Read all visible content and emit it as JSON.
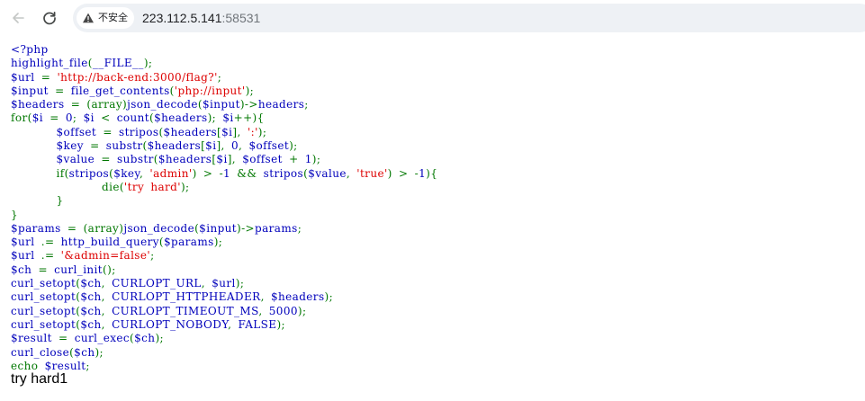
{
  "browser": {
    "security_label": "不安全",
    "url_host": "223.112.5.141",
    "url_port": ":58531",
    "icons": {
      "back": "arrow-left-icon",
      "reload": "reload-icon",
      "security": "warning-triangle-icon"
    }
  },
  "colors": {
    "php_default": "#0000bb",
    "php_keyword": "#007700",
    "php_string": "#dd0000",
    "php_html": "#000000"
  },
  "code_lines": [
    [
      {
        "t": "&lt;?php",
        "c": "default"
      }
    ],
    [
      {
        "t": "highlight_file",
        "c": "default"
      },
      {
        "t": "(",
        "c": "keyword"
      },
      {
        "t": "__FILE__",
        "c": "default"
      },
      {
        "t": ");",
        "c": "keyword"
      }
    ],
    [
      {
        "t": "$url ",
        "c": "default"
      },
      {
        "t": "= ",
        "c": "keyword"
      },
      {
        "t": "'http://back-end:3000/flag?'",
        "c": "string"
      },
      {
        "t": ";",
        "c": "keyword"
      }
    ],
    [
      {
        "t": "$input ",
        "c": "default"
      },
      {
        "t": "= ",
        "c": "keyword"
      },
      {
        "t": "file_get_contents",
        "c": "default"
      },
      {
        "t": "(",
        "c": "keyword"
      },
      {
        "t": "'php://input'",
        "c": "string"
      },
      {
        "t": ");",
        "c": "keyword"
      }
    ],
    [
      {
        "t": "$headers ",
        "c": "default"
      },
      {
        "t": "= (array)",
        "c": "keyword"
      },
      {
        "t": "json_decode",
        "c": "default"
      },
      {
        "t": "(",
        "c": "keyword"
      },
      {
        "t": "$input",
        "c": "default"
      },
      {
        "t": ")-&gt;",
        "c": "keyword"
      },
      {
        "t": "headers",
        "c": "default"
      },
      {
        "t": ";",
        "c": "keyword"
      }
    ],
    [
      {
        "t": "for(",
        "c": "keyword"
      },
      {
        "t": "$i ",
        "c": "default"
      },
      {
        "t": "= ",
        "c": "keyword"
      },
      {
        "t": "0",
        "c": "default"
      },
      {
        "t": "; ",
        "c": "keyword"
      },
      {
        "t": "$i ",
        "c": "default"
      },
      {
        "t": "&lt; ",
        "c": "keyword"
      },
      {
        "t": "count",
        "c": "default"
      },
      {
        "t": "(",
        "c": "keyword"
      },
      {
        "t": "$headers",
        "c": "default"
      },
      {
        "t": "); ",
        "c": "keyword"
      },
      {
        "t": "$i",
        "c": "default"
      },
      {
        "t": "++){",
        "c": "keyword"
      }
    ],
    [
      {
        "t": "       ",
        "c": "keyword"
      },
      {
        "t": "$offset ",
        "c": "default"
      },
      {
        "t": "= ",
        "c": "keyword"
      },
      {
        "t": "stripos",
        "c": "default"
      },
      {
        "t": "(",
        "c": "keyword"
      },
      {
        "t": "$headers",
        "c": "default"
      },
      {
        "t": "[",
        "c": "keyword"
      },
      {
        "t": "$i",
        "c": "default"
      },
      {
        "t": "], ",
        "c": "keyword"
      },
      {
        "t": "':'",
        "c": "string"
      },
      {
        "t": ");",
        "c": "keyword"
      }
    ],
    [
      {
        "t": "       ",
        "c": "keyword"
      },
      {
        "t": "$key ",
        "c": "default"
      },
      {
        "t": "= ",
        "c": "keyword"
      },
      {
        "t": "substr",
        "c": "default"
      },
      {
        "t": "(",
        "c": "keyword"
      },
      {
        "t": "$headers",
        "c": "default"
      },
      {
        "t": "[",
        "c": "keyword"
      },
      {
        "t": "$i",
        "c": "default"
      },
      {
        "t": "], ",
        "c": "keyword"
      },
      {
        "t": "0",
        "c": "default"
      },
      {
        "t": ", ",
        "c": "keyword"
      },
      {
        "t": "$offset",
        "c": "default"
      },
      {
        "t": ");",
        "c": "keyword"
      }
    ],
    [
      {
        "t": "       ",
        "c": "keyword"
      },
      {
        "t": "$value ",
        "c": "default"
      },
      {
        "t": "= ",
        "c": "keyword"
      },
      {
        "t": "substr",
        "c": "default"
      },
      {
        "t": "(",
        "c": "keyword"
      },
      {
        "t": "$headers",
        "c": "default"
      },
      {
        "t": "[",
        "c": "keyword"
      },
      {
        "t": "$i",
        "c": "default"
      },
      {
        "t": "], ",
        "c": "keyword"
      },
      {
        "t": "$offset ",
        "c": "default"
      },
      {
        "t": "+ ",
        "c": "keyword"
      },
      {
        "t": "1",
        "c": "default"
      },
      {
        "t": ");",
        "c": "keyword"
      }
    ],
    [
      {
        "t": "       if(",
        "c": "keyword"
      },
      {
        "t": "stripos",
        "c": "default"
      },
      {
        "t": "(",
        "c": "keyword"
      },
      {
        "t": "$key",
        "c": "default"
      },
      {
        "t": ", ",
        "c": "keyword"
      },
      {
        "t": "'admin'",
        "c": "string"
      },
      {
        "t": ") &gt; -",
        "c": "keyword"
      },
      {
        "t": "1 ",
        "c": "default"
      },
      {
        "t": "&amp;&amp; ",
        "c": "keyword"
      },
      {
        "t": "stripos",
        "c": "default"
      },
      {
        "t": "(",
        "c": "keyword"
      },
      {
        "t": "$value",
        "c": "default"
      },
      {
        "t": ", ",
        "c": "keyword"
      },
      {
        "t": "'true'",
        "c": "string"
      },
      {
        "t": ") &gt; -",
        "c": "keyword"
      },
      {
        "t": "1",
        "c": "default"
      },
      {
        "t": "){",
        "c": "keyword"
      }
    ],
    [
      {
        "t": "              die(",
        "c": "keyword"
      },
      {
        "t": "'try hard'",
        "c": "string"
      },
      {
        "t": ");",
        "c": "keyword"
      }
    ],
    [
      {
        "t": "       }",
        "c": "keyword"
      }
    ],
    [
      {
        "t": "}",
        "c": "keyword"
      }
    ],
    [
      {
        "t": "$params ",
        "c": "default"
      },
      {
        "t": "= (array)",
        "c": "keyword"
      },
      {
        "t": "json_decode",
        "c": "default"
      },
      {
        "t": "(",
        "c": "keyword"
      },
      {
        "t": "$input",
        "c": "default"
      },
      {
        "t": ")-&gt;",
        "c": "keyword"
      },
      {
        "t": "params",
        "c": "default"
      },
      {
        "t": ";",
        "c": "keyword"
      }
    ],
    [
      {
        "t": "$url ",
        "c": "default"
      },
      {
        "t": ".= ",
        "c": "keyword"
      },
      {
        "t": "http_build_query",
        "c": "default"
      },
      {
        "t": "(",
        "c": "keyword"
      },
      {
        "t": "$params",
        "c": "default"
      },
      {
        "t": ");",
        "c": "keyword"
      }
    ],
    [
      {
        "t": "$url ",
        "c": "default"
      },
      {
        "t": ".= ",
        "c": "keyword"
      },
      {
        "t": "'&amp;admin=false'",
        "c": "string"
      },
      {
        "t": ";",
        "c": "keyword"
      }
    ],
    [
      {
        "t": "$ch ",
        "c": "default"
      },
      {
        "t": "= ",
        "c": "keyword"
      },
      {
        "t": "curl_init",
        "c": "default"
      },
      {
        "t": "();",
        "c": "keyword"
      }
    ],
    [
      {
        "t": "curl_setopt",
        "c": "default"
      },
      {
        "t": "(",
        "c": "keyword"
      },
      {
        "t": "$ch",
        "c": "default"
      },
      {
        "t": ", ",
        "c": "keyword"
      },
      {
        "t": "CURLOPT_URL",
        "c": "default"
      },
      {
        "t": ", ",
        "c": "keyword"
      },
      {
        "t": "$url",
        "c": "default"
      },
      {
        "t": ");",
        "c": "keyword"
      }
    ],
    [
      {
        "t": "curl_setopt",
        "c": "default"
      },
      {
        "t": "(",
        "c": "keyword"
      },
      {
        "t": "$ch",
        "c": "default"
      },
      {
        "t": ", ",
        "c": "keyword"
      },
      {
        "t": "CURLOPT_HTTPHEADER",
        "c": "default"
      },
      {
        "t": ", ",
        "c": "keyword"
      },
      {
        "t": "$headers",
        "c": "default"
      },
      {
        "t": ");",
        "c": "keyword"
      }
    ],
    [
      {
        "t": "curl_setopt",
        "c": "default"
      },
      {
        "t": "(",
        "c": "keyword"
      },
      {
        "t": "$ch",
        "c": "default"
      },
      {
        "t": ", ",
        "c": "keyword"
      },
      {
        "t": "CURLOPT_TIMEOUT_MS",
        "c": "default"
      },
      {
        "t": ", ",
        "c": "keyword"
      },
      {
        "t": "5000",
        "c": "default"
      },
      {
        "t": ");",
        "c": "keyword"
      }
    ],
    [
      {
        "t": "curl_setopt",
        "c": "default"
      },
      {
        "t": "(",
        "c": "keyword"
      },
      {
        "t": "$ch",
        "c": "default"
      },
      {
        "t": ", ",
        "c": "keyword"
      },
      {
        "t": "CURLOPT_NOBODY",
        "c": "default"
      },
      {
        "t": ", ",
        "c": "keyword"
      },
      {
        "t": "FALSE",
        "c": "default"
      },
      {
        "t": ");",
        "c": "keyword"
      }
    ],
    [
      {
        "t": "$result ",
        "c": "default"
      },
      {
        "t": "= ",
        "c": "keyword"
      },
      {
        "t": "curl_exec",
        "c": "default"
      },
      {
        "t": "(",
        "c": "keyword"
      },
      {
        "t": "$ch",
        "c": "default"
      },
      {
        "t": ");",
        "c": "keyword"
      }
    ],
    [
      {
        "t": "curl_close",
        "c": "default"
      },
      {
        "t": "(",
        "c": "keyword"
      },
      {
        "t": "$ch",
        "c": "default"
      },
      {
        "t": ");",
        "c": "keyword"
      }
    ],
    [
      {
        "t": "echo ",
        "c": "keyword"
      },
      {
        "t": "$result",
        "c": "default"
      },
      {
        "t": ";",
        "c": "keyword"
      }
    ]
  ],
  "output_text": "try hard1"
}
